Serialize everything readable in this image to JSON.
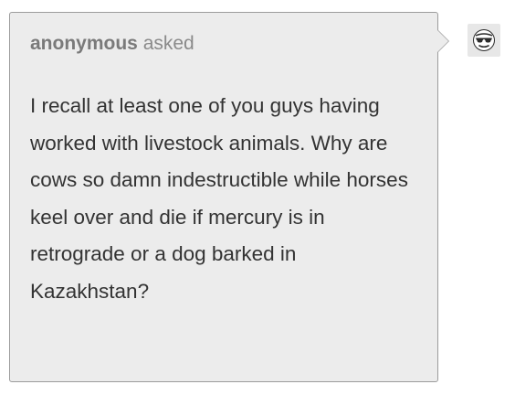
{
  "ask": {
    "asker_name": "anonymous",
    "asked_word": "asked",
    "question": "I recall at least one of you guys having worked with livestock animals. Why are cows so damn indestructible while horses keel over and die if mercury is in retrograde or a dog barked in Kazakhstan?"
  },
  "avatar": {
    "icon": "anonymous-sunglasses-avatar-icon"
  },
  "colors": {
    "bubble_bg": "#ececec",
    "bubble_border": "#9c9c9c",
    "asker_text": "#8a8a8a",
    "body_text": "#333333"
  }
}
